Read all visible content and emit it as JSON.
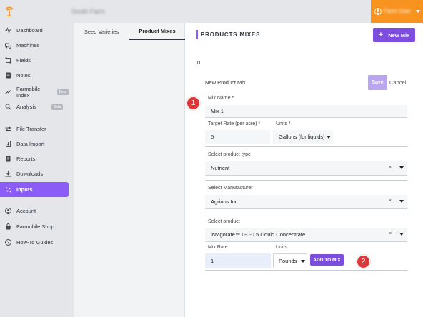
{
  "topbar": {
    "farm_name": "South Farm",
    "user_name": "Farm User"
  },
  "sidebar": {
    "items": [
      {
        "label": "Dashboard",
        "icon": "pulse-icon"
      },
      {
        "label": "Machines",
        "icon": "machine-icon"
      },
      {
        "label": "Fields",
        "icon": "field-icon"
      },
      {
        "label": "Notes",
        "icon": "note-icon"
      },
      {
        "label": "Farmobile Index",
        "icon": "trend-icon",
        "badge": "Beta"
      },
      {
        "label": "Analysis",
        "icon": "search-icon",
        "badge": "Beta"
      },
      {
        "label": "File Transfer",
        "icon": "transfer-icon"
      },
      {
        "label": "Data Import",
        "icon": "import-icon"
      },
      {
        "label": "Reports",
        "icon": "report-icon"
      },
      {
        "label": "Downloads",
        "icon": "download-icon"
      },
      {
        "label": "Inputs",
        "icon": "inputs-icon",
        "active": true
      },
      {
        "label": "Account",
        "icon": "account-icon"
      },
      {
        "label": "Farmobile Shop",
        "icon": "shop-icon"
      },
      {
        "label": "How-To Guides",
        "icon": "help-icon"
      }
    ]
  },
  "tabs": [
    {
      "label": "Seed Varieties"
    },
    {
      "label": "Product Mixes",
      "active": true
    }
  ],
  "main": {
    "title": "PRODUCTS MIXES",
    "new_mix_label": "New Mix",
    "count": "0",
    "form_title": "New Product Mix",
    "save_label": "Save",
    "cancel_label": "Cancel"
  },
  "form": {
    "mix_name_label": "Mix Name *",
    "mix_name_value": "Mix 1",
    "target_rate_label": "Target Rate (per acre) *",
    "target_rate_value": "5",
    "units_label": "Units *",
    "units_value": "Gallons (for liquids)",
    "product_type_label": "Select product type",
    "product_type_value": "Nutrient",
    "manufacturer_label": "Select Manufacturer",
    "manufacturer_value": "Agrinos Inc.",
    "product_label": "Select product",
    "product_value": "iNvigorate™ 0-0-0.5 Liquid Concentrate",
    "clear_glyph": "×",
    "mix_rate_label": "Mix Rate",
    "mix_rate_value": "1",
    "mix_units_label": "Units",
    "mix_units_value": "Pounds",
    "add_to_mix_label": "ADD TO MIX"
  },
  "markers": [
    "1",
    "2"
  ],
  "colors": {
    "accent": "#7c4ddf",
    "active_nav": "#8b5cf6",
    "user_menu": "#f7931e",
    "marker": "#e03838",
    "sidebar_bg": "#e4e6ea"
  }
}
